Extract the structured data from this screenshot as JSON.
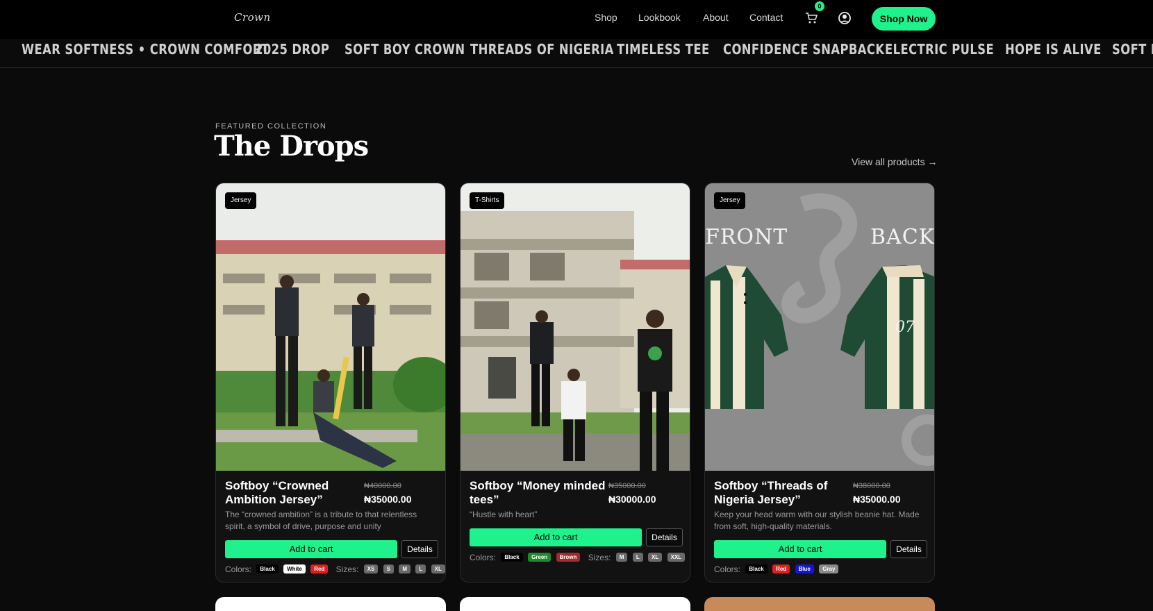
{
  "header": {
    "logo": "Crown",
    "nav": [
      "Shop",
      "Lookbook",
      "About",
      "Contact"
    ],
    "cart_count": "0",
    "shop_now": "Shop Now"
  },
  "marquee": [
    "WEAR SOFTNESS • CROWN COMFORT",
    "2025 DROP",
    "SOFT BOY CROWN",
    "THREADS OF NIGERIA",
    "TIMELESS TEE",
    "CONFIDENCE SNAPBACK",
    "ELECTRIC PULSE",
    "HOPE IS ALIVE",
    "SOFT P"
  ],
  "section": {
    "eyebrow": "FEATURED COLLECTION",
    "title": "The Drops",
    "view_all": "View all products →"
  },
  "colors": {
    "accent": "#1ff28c",
    "background": "#0b0b0b"
  },
  "products": [
    {
      "tag": "Jersey",
      "name": "Softboy “Crowned Ambition Jersey”",
      "old_price": "₦40000.00",
      "price": "₦35000.00",
      "desc": "The “crowned ambition” is a tribute to that relentless spirit, a symbol of drive, purpose and unity",
      "add": "Add to cart",
      "details": "Details",
      "colors_label": "Colors:",
      "colors": [
        "Black",
        "White",
        "Red"
      ],
      "sizes_label": "Sizes:",
      "sizes": [
        "XS",
        "S",
        "M",
        "L",
        "XL"
      ]
    },
    {
      "tag": "T-Shirts",
      "name": "Softboy “Money minded tees”",
      "old_price": "₦35000.00",
      "price": "₦30000.00",
      "desc": "“Hustle with heart”",
      "add": "Add to cart",
      "details": "Details",
      "colors_label": "Colors:",
      "colors": [
        "Black",
        "Green",
        "Brown"
      ],
      "sizes_label": "Sizes:",
      "sizes": [
        "M",
        "L",
        "XL",
        "XXL"
      ]
    },
    {
      "tag": "Jersey",
      "name": "Softboy “Threads of Nigeria Jersey”",
      "old_price": "₦38000.00",
      "price": "₦35000.00",
      "desc": "Keep your head warm with our stylish beanie hat. Made from soft, high-quality materials.",
      "add": "Add to cart",
      "details": "Details",
      "colors_label": "Colors:",
      "colors": [
        "Black",
        "Red",
        "Blue",
        "Gray"
      ],
      "image_text_front": "FRONT",
      "image_text_back": "BACK",
      "image_number": "07"
    }
  ]
}
